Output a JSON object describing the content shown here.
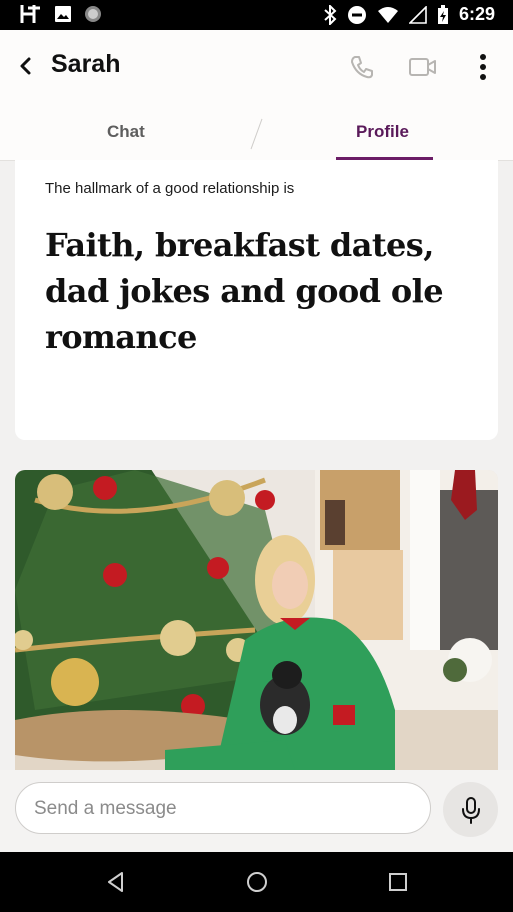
{
  "status_bar": {
    "time": "6:29",
    "left_icons": [
      "hinge-logo-icon",
      "image-icon",
      "circle-notification-icon"
    ],
    "right_icons": [
      "bluetooth-icon",
      "dnd-icon",
      "wifi-icon",
      "signal-icon",
      "battery-icon"
    ]
  },
  "header": {
    "back_icon": "chevron-left-icon",
    "title": "Sarah",
    "call_icon": "phone-icon",
    "video_icon": "video-camera-icon",
    "menu_icon": "more-vertical-icon"
  },
  "tabs": [
    {
      "label": "Chat",
      "selected": false
    },
    {
      "label": "Profile",
      "selected": true
    }
  ],
  "prompt_card": {
    "prompt": "The hallmark of a good relationship is",
    "answer": "Faith, breakfast dates, dad jokes and good ole romance"
  },
  "photo": {
    "icon": "christmas-photo"
  },
  "composer": {
    "placeholder": "Send a message",
    "mic_icon": "microphone-icon"
  },
  "nav_bar": {
    "icons": [
      "back-triangle-icon",
      "home-circle-icon",
      "recents-square-icon"
    ]
  },
  "colors": {
    "accent": "#6b1d66",
    "background": "#f2f1f0"
  }
}
